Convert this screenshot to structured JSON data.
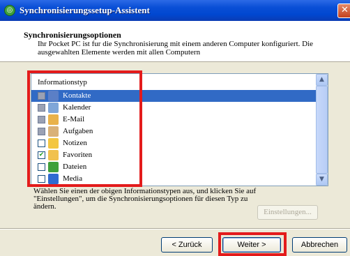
{
  "window": {
    "title": "Synchronisierungssetup-Assistent",
    "close_glyph": "✕",
    "app_icon_glyph": "◎"
  },
  "header": {
    "title": "Synchronisierungsoptionen",
    "description": "Ihr Pocket PC ist fur die Synchronisierung mit einem anderen Computer konfiguriert. Die ausgewahlten Elemente werden mit allen Computern"
  },
  "list": {
    "header": "Informationstyp",
    "items": [
      {
        "label": "Kontakte",
        "check": "",
        "state": "indeterminate",
        "icon": "contacts-icon",
        "color": "#5b7fc6",
        "selected": true
      },
      {
        "label": "Kalender",
        "check": "",
        "state": "indeterminate",
        "icon": "calendar-icon",
        "color": "#7fa6d8",
        "selected": false
      },
      {
        "label": "E-Mail",
        "check": "",
        "state": "indeterminate",
        "icon": "email-icon",
        "color": "#e9b24a",
        "selected": false
      },
      {
        "label": "Aufgaben",
        "check": "",
        "state": "indeterminate",
        "icon": "tasks-icon",
        "color": "#d9b178",
        "selected": false
      },
      {
        "label": "Notizen",
        "check": "",
        "state": "unchecked",
        "icon": "notes-icon",
        "color": "#f3c642",
        "selected": false
      },
      {
        "label": "Favoriten",
        "check": "✔",
        "state": "checked",
        "icon": "favorites-folder-icon",
        "color": "#f1c14e",
        "selected": false
      },
      {
        "label": "Dateien",
        "check": "",
        "state": "unchecked",
        "icon": "files-sync-icon",
        "color": "#3fa03a",
        "selected": false
      },
      {
        "label": "Media",
        "check": "",
        "state": "unchecked",
        "icon": "media-icon",
        "color": "#2f6ad0",
        "selected": false
      }
    ],
    "scroll_up_glyph": "▲",
    "scroll_down_glyph": "▼"
  },
  "hint": "Wählen Sie einen der obigen Informationstypen aus, und klicken Sie auf \"Einstellungen\", um die Synchronisierungsoptionen für diesen Typ zu ändern.",
  "buttons": {
    "settings": "Einstellungen...",
    "back": "< Zurück",
    "next": "Weiter >",
    "cancel": "Abbrechen"
  },
  "colors": {
    "titlebar": "#0a4fd6",
    "selection": "#316ac5",
    "annotation": "#e31b1b"
  }
}
